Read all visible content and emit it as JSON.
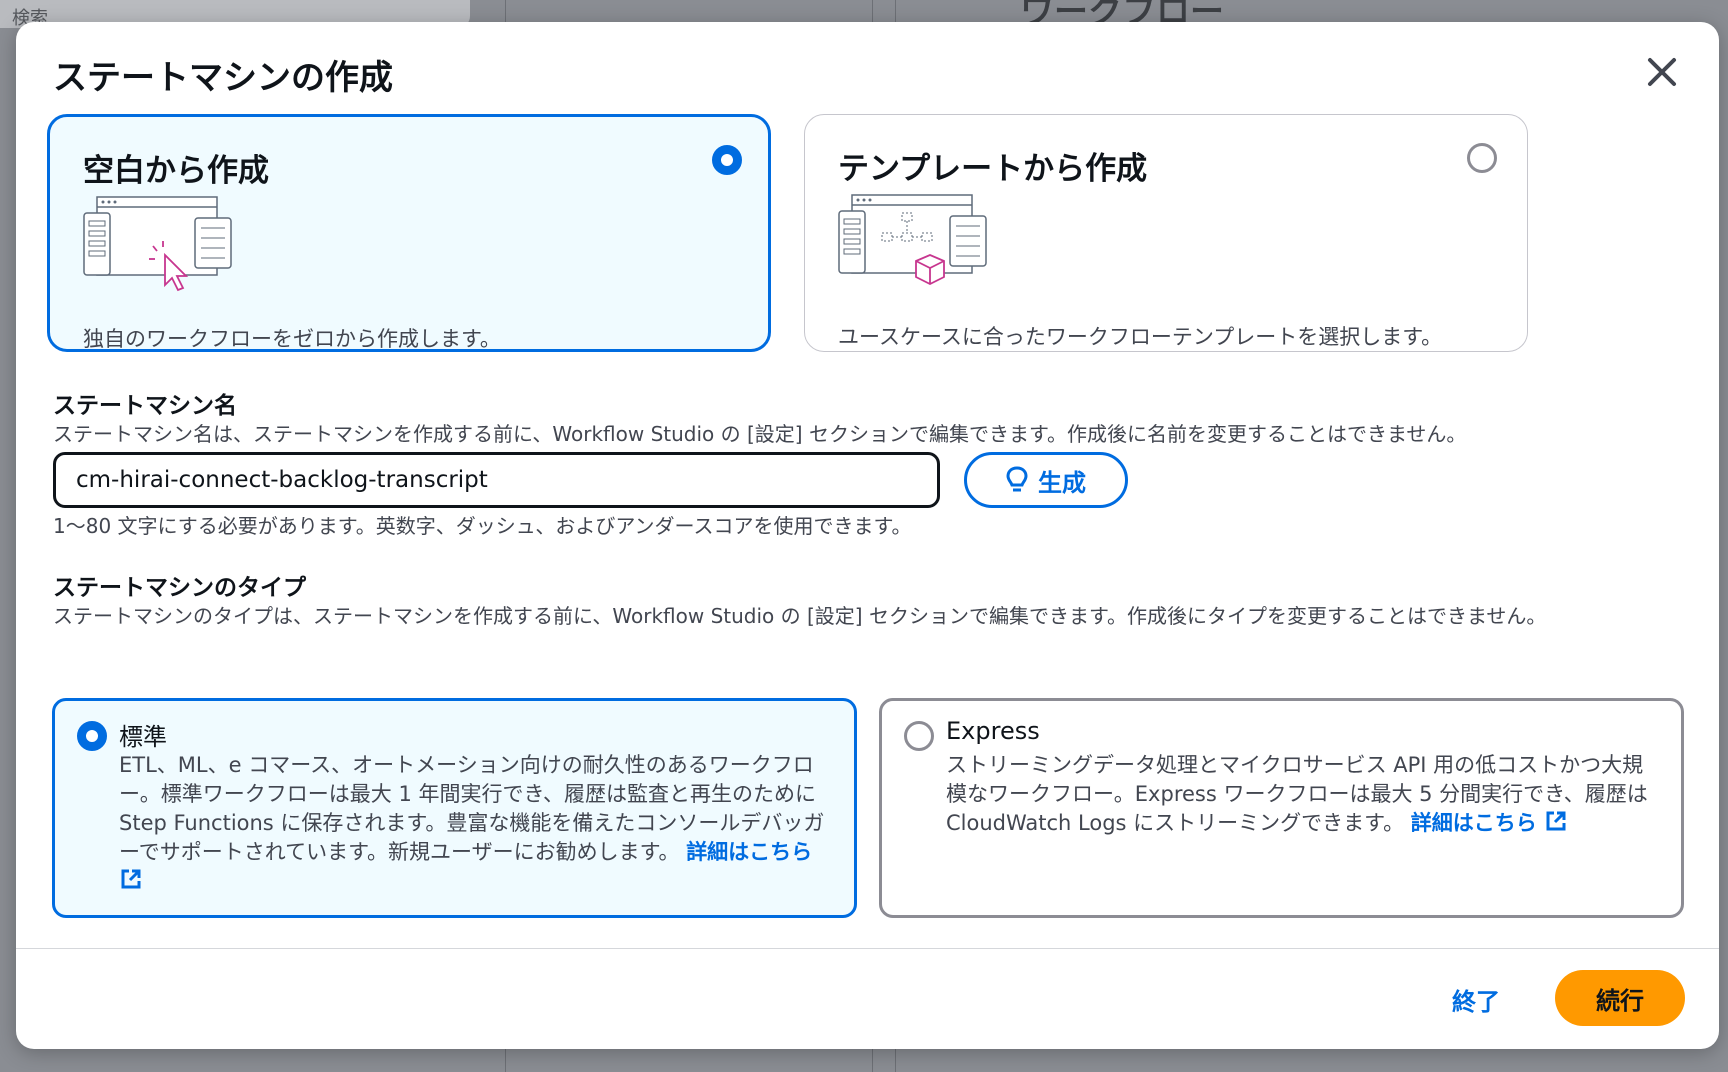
{
  "background": {
    "search_placeholder": "検索",
    "page_title": "ワークフロー"
  },
  "modal": {
    "title": "ステートマシンの作成",
    "create_options": [
      {
        "title": "空白から作成",
        "description": "独自のワークフローをゼロから作成します。",
        "selected": true,
        "icon": "blank-workflow-icon"
      },
      {
        "title": "テンプレートから作成",
        "description": "ユースケースに合ったワークフローテンプレートを選択します。",
        "selected": false,
        "icon": "template-workflow-icon"
      }
    ],
    "name_section": {
      "label": "ステートマシン名",
      "description": "ステートマシン名は、ステートマシンを作成する前に、Workflow Studio の [設定] セクションで編集できます。作成後に名前を変更することはできません。",
      "value": "cm-hirai-connect-backlog-transcript",
      "generate_label": "生成",
      "hint": "1〜80 文字にする必要があります。英数字、ダッシュ、およびアンダースコアを使用できます。"
    },
    "type_section": {
      "label": "ステートマシンのタイプ",
      "description": "ステートマシンのタイプは、ステートマシンを作成する前に、Workflow Studio の [設定] セクションで編集できます。作成後にタイプを変更することはできません。",
      "types": [
        {
          "title": "標準",
          "selected": true,
          "description": "ETL、ML、e コマース、オートメーション向けの耐久性のあるワークフロー。標準ワークフローは最大 1 年間実行でき、履歴は監査と再生のために Step Functions に保存されます。豊富な機能を備えたコンソールデバッガーでサポートされています。新規ユーザーにお勧めします。",
          "link": "詳細はこちら"
        },
        {
          "title": "Express",
          "selected": false,
          "description": "ストリーミングデータ処理とマイクロサービス API 用の低コストかつ大規模なワークフロー。Express ワークフローは最大 5 分間実行でき、履歴は CloudWatch Logs にストリーミングできます。",
          "link": "詳細はこちら"
        }
      ]
    },
    "footer": {
      "cancel_label": "終了",
      "continue_label": "続行"
    }
  },
  "colors": {
    "accent": "#006ce0",
    "primary_button": "#ff9900",
    "selected_bg": "#f0fbff"
  }
}
